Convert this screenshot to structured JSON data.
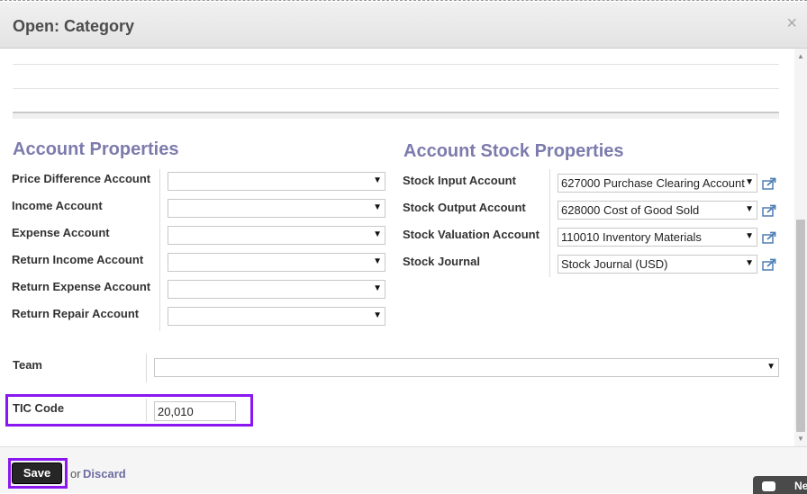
{
  "dialog": {
    "title": "Open: Category",
    "close_symbol": "×"
  },
  "account_properties": {
    "title": "Account Properties",
    "fields": [
      {
        "label": "Price Difference Account",
        "value": ""
      },
      {
        "label": "Income Account",
        "value": ""
      },
      {
        "label": "Expense Account",
        "value": ""
      },
      {
        "label": "Return Income Account",
        "value": ""
      },
      {
        "label": "Return Expense Account",
        "value": ""
      },
      {
        "label": "Return Repair Account",
        "value": ""
      }
    ]
  },
  "stock_properties": {
    "title": "Account Stock Properties",
    "fields": [
      {
        "label": "Stock Input Account",
        "value": "627000 Purchase Clearing Account"
      },
      {
        "label": "Stock Output Account",
        "value": "628000 Cost of Good Sold"
      },
      {
        "label": "Stock Valuation Account",
        "value": "110010 Inventory Materials"
      },
      {
        "label": "Stock Journal",
        "value": "Stock Journal (USD)"
      }
    ]
  },
  "team": {
    "label": "Team",
    "value": ""
  },
  "tic_code": {
    "label": "TIC Code",
    "value": "20,010"
  },
  "footer": {
    "save_label": "Save",
    "or_text": "or",
    "discard_label": "Discard"
  },
  "chat": {
    "label": "Ne"
  },
  "icons": {
    "close": "close-icon",
    "dropdown": "caret-down-icon",
    "external": "external-link-icon",
    "chat": "chat-bubble-icon"
  },
  "colors": {
    "section_title": "#7c7bad",
    "highlight": "#8b17f0",
    "link": "#6d6da3",
    "external_icon": "#4f7eb4"
  }
}
